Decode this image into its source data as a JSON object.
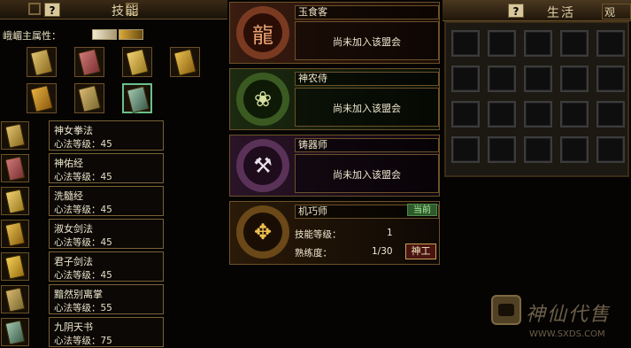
{
  "left": {
    "help_label": "?",
    "header_title": "技能",
    "attribute_label": "峨嵋主属性：",
    "attribute_books": [
      {
        "icon": "white-book-icon"
      },
      {
        "icon": "gold-book-icon"
      }
    ],
    "grid_books": [
      {
        "icon": "scroll-book-icon",
        "color": "#b89a4a"
      },
      {
        "icon": "scroll-book-icon",
        "color": "#9a5a5a"
      },
      {
        "icon": "scroll-book-icon",
        "color": "#c8a040"
      },
      {
        "icon": "scroll-book-icon",
        "color": "#c89a30"
      },
      {
        "icon": "scroll-book-icon",
        "color": "#b88a30"
      },
      {
        "icon": "scroll-book-icon",
        "color": "#a88a4a"
      },
      {
        "icon": "scroll-book-icon",
        "color": "#6a8a7a"
      }
    ],
    "skills": [
      {
        "name": "神女拳法",
        "level": "心法等级：45",
        "color": "#b89a4a"
      },
      {
        "name": "神佑经",
        "level": "心法等级：45",
        "color": "#9a5a5a"
      },
      {
        "name": "洗髓经",
        "level": "心法等级：45",
        "color": "#c8a040"
      },
      {
        "name": "淑女剑法",
        "level": "心法等级：45",
        "color": "#c89a30"
      },
      {
        "name": "君子剑法",
        "level": "心法等级：45",
        "color": "#d8b040"
      },
      {
        "name": "黯然别离掌",
        "level": "心法等级：55",
        "color": "#a88a4a"
      },
      {
        "name": "九阴天书",
        "level": "心法等级：75",
        "color": "#6a8a7a"
      }
    ]
  },
  "guilds": [
    {
      "name": "玉食客",
      "status": "尚未加入该盟会",
      "emblem": "dragon-emblem-icon",
      "bg": "#3a1c10",
      "ring": "#7a3a22",
      "glyph": "龍"
    },
    {
      "name": "神农侍",
      "status": "尚未加入该盟会",
      "emblem": "herb-emblem-icon",
      "bg": "#1c2a10",
      "ring": "#3a5a22",
      "glyph": "❀"
    },
    {
      "name": "铸器师",
      "status": "尚未加入该盟会",
      "emblem": "forge-emblem-icon",
      "bg": "#2a1428",
      "ring": "#5a3258",
      "glyph": "⚒"
    },
    {
      "name": "机巧师",
      "emblem": "gear-emblem-icon",
      "bg": "#2a1a08",
      "ring": "#6a4818",
      "glyph": "✥",
      "current_label": "当前",
      "skill_level_label": "技能等级：",
      "skill_level_value": "1",
      "proficiency_label": "熟练度：",
      "proficiency_value": "1/30",
      "action_label": "神工"
    }
  ],
  "right": {
    "help_label": "?",
    "header_title": "生活",
    "tab_label": "观"
  },
  "watermark": {
    "brand": "神仙代售",
    "url": "WWW.SXDS.COM"
  }
}
